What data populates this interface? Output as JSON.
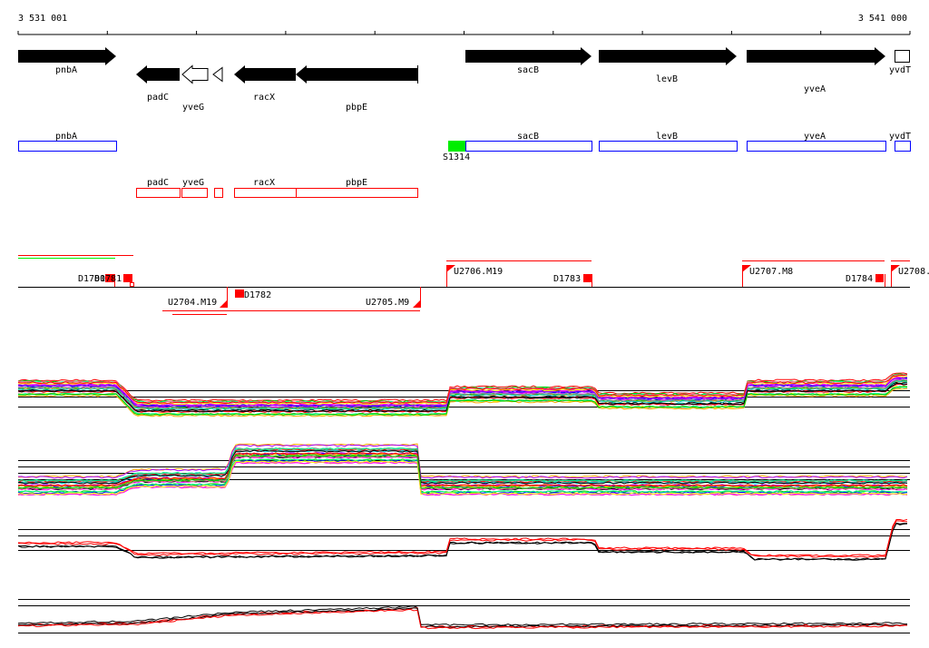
{
  "ruler": {
    "start": "3 531 001",
    "end": "3 541 000"
  },
  "genes_forward": [
    {
      "name": "pnbA"
    },
    {
      "name": "sacB"
    },
    {
      "name": "levB"
    },
    {
      "name": "yveA"
    },
    {
      "name": "yvdT"
    }
  ],
  "genes_reverse": [
    {
      "name": "padC"
    },
    {
      "name": "yveG"
    },
    {
      "name": "racX"
    },
    {
      "name": "pbpE"
    }
  ],
  "annot_forward": [
    {
      "name": "pnbA"
    },
    {
      "name": "sacB"
    },
    {
      "name": "levB"
    },
    {
      "name": "yveA"
    },
    {
      "name": "yvdT"
    }
  ],
  "srna": {
    "name": "S1314",
    "color": "#00ee00"
  },
  "annot_reverse": [
    {
      "name": "padC"
    },
    {
      "name": "yveG"
    },
    {
      "name": "racX"
    },
    {
      "name": "pbpE"
    }
  ],
  "transcripts": {
    "upshifts": [
      "U2704.M19",
      "U2705.M9",
      "U2706.M19",
      "U2707.M8",
      "U2708."
    ],
    "downshifts": [
      "D1780",
      "D1781",
      "D1782",
      "D1783",
      "D1784"
    ]
  },
  "colors": {
    "forward": "#0000ff",
    "reverse": "#ff0000",
    "marker": "#ff0000"
  }
}
